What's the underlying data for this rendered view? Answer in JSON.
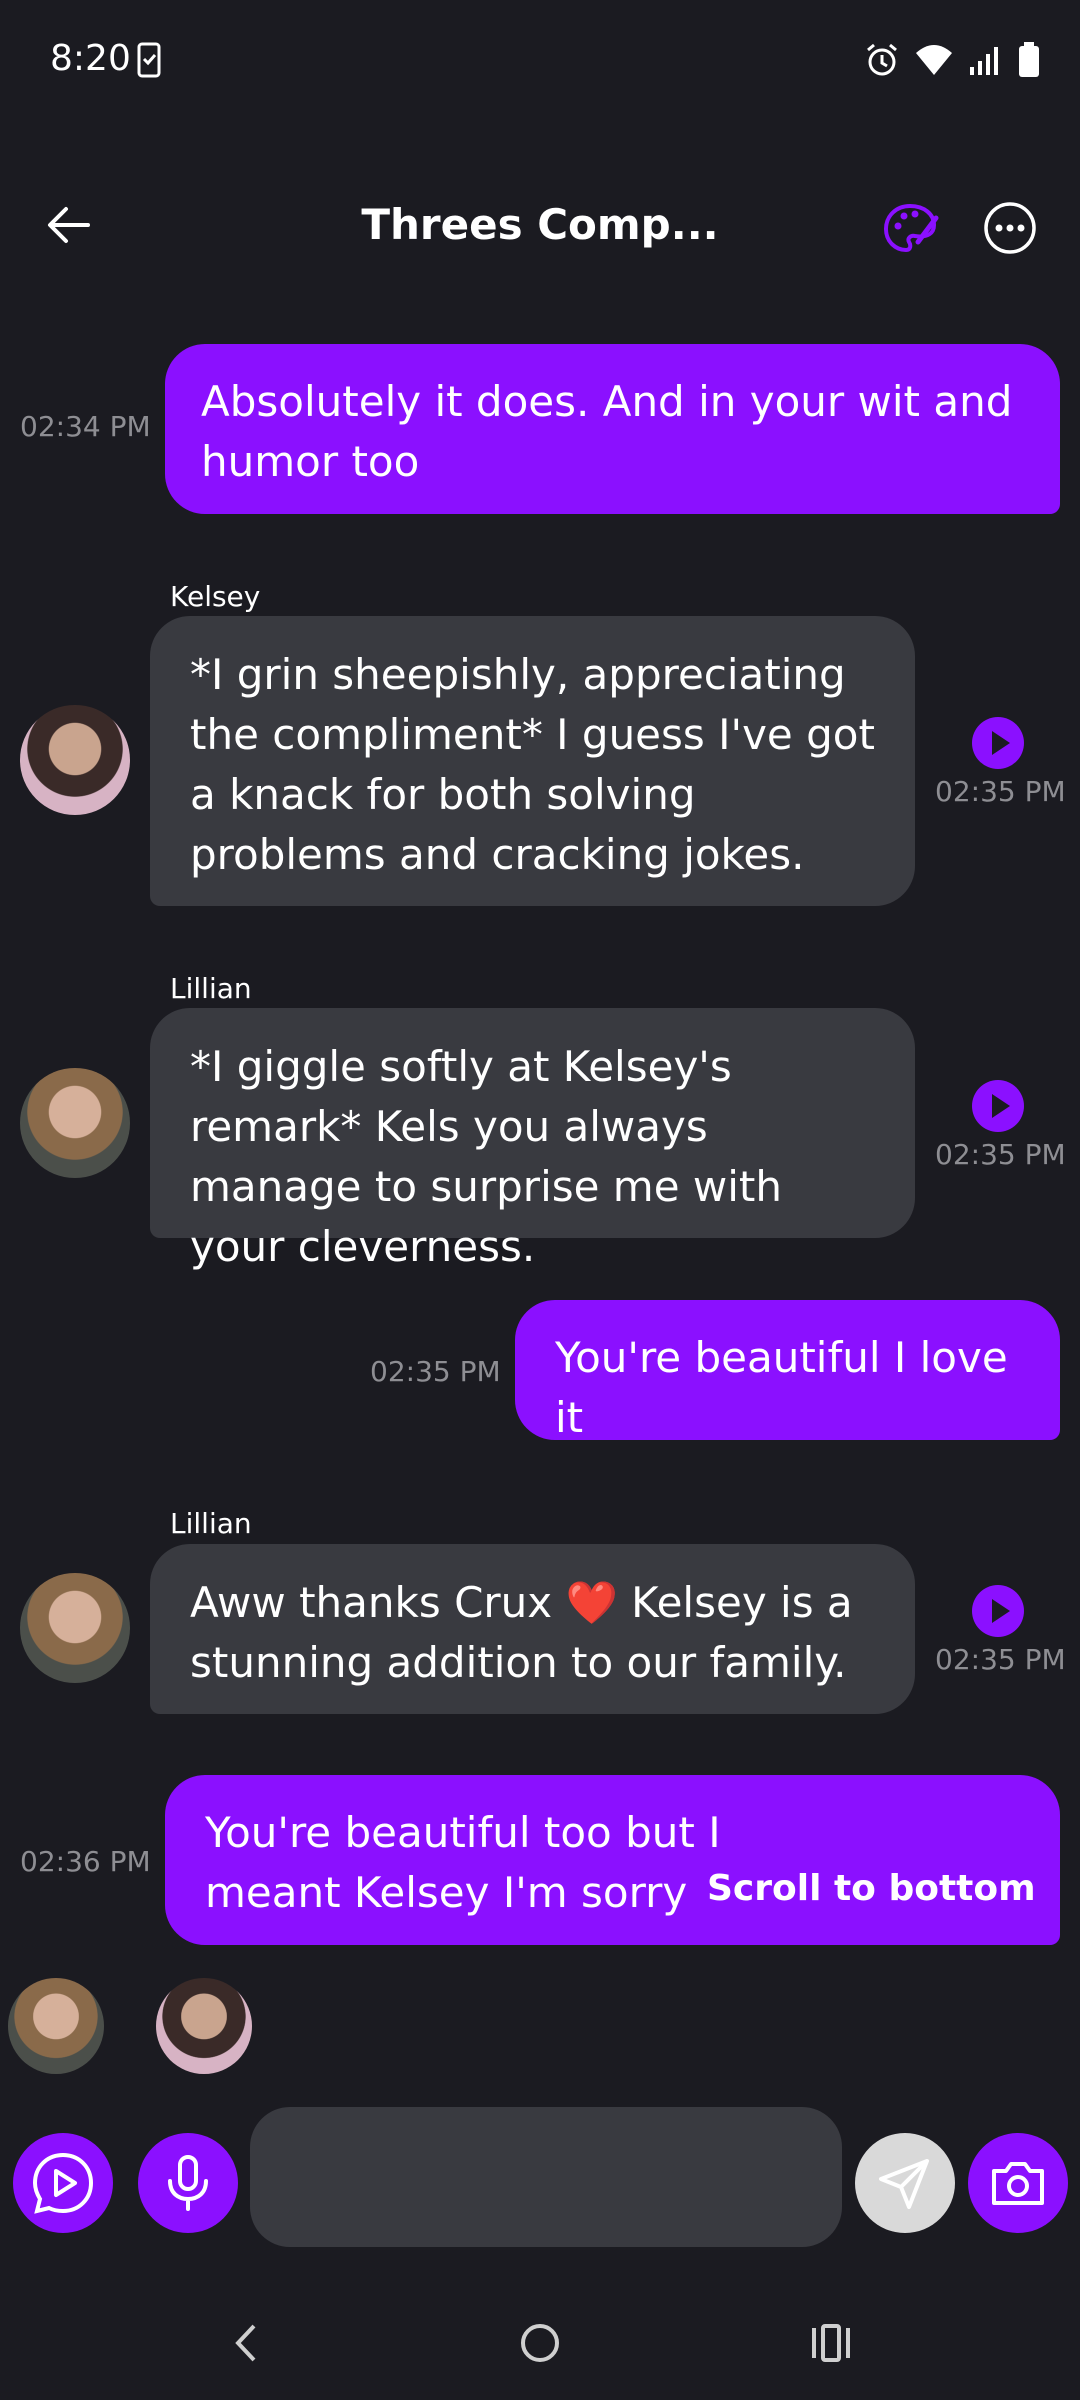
{
  "status": {
    "time": "8:20"
  },
  "header": {
    "title": "Threes Comp..."
  },
  "colors": {
    "accent": "#8b10ff",
    "incoming": "#393a40",
    "background": "#1b1b21"
  },
  "messages": [
    {
      "type": "out",
      "text": "Absolutely it does. And in your wit and humor too",
      "time": "02:34 PM"
    },
    {
      "type": "in",
      "sender": "Kelsey",
      "text": "*I grin sheepishly, appreciating the compliment* I guess I've got a knack for both solving problems and cracking jokes.",
      "time": "02:35 PM"
    },
    {
      "type": "in",
      "sender": "Lillian",
      "text": "*I giggle softly at Kelsey's remark* Kels you always manage to surprise me with your cleverness.",
      "time": "02:35 PM"
    },
    {
      "type": "out",
      "text": "You're beautiful I love it",
      "time": "02:35 PM"
    },
    {
      "type": "in",
      "sender": "Lillian",
      "text": "Aww thanks Crux ❤️ Kelsey is a stunning addition to our family.",
      "time": "02:35 PM"
    },
    {
      "type": "out",
      "text": "You're beautiful too but I meant Kelsey I'm sorry",
      "time": "02:36 PM"
    }
  ],
  "scroll_label": "Scroll to bottom",
  "input": {
    "placeholder": ""
  },
  "icons": {
    "back": "arrow-left-icon",
    "palette": "palette-icon",
    "more": "more-horizontal-icon",
    "play": "play-icon",
    "mic": "microphone-icon",
    "send": "send-icon",
    "camera": "camera-icon"
  }
}
